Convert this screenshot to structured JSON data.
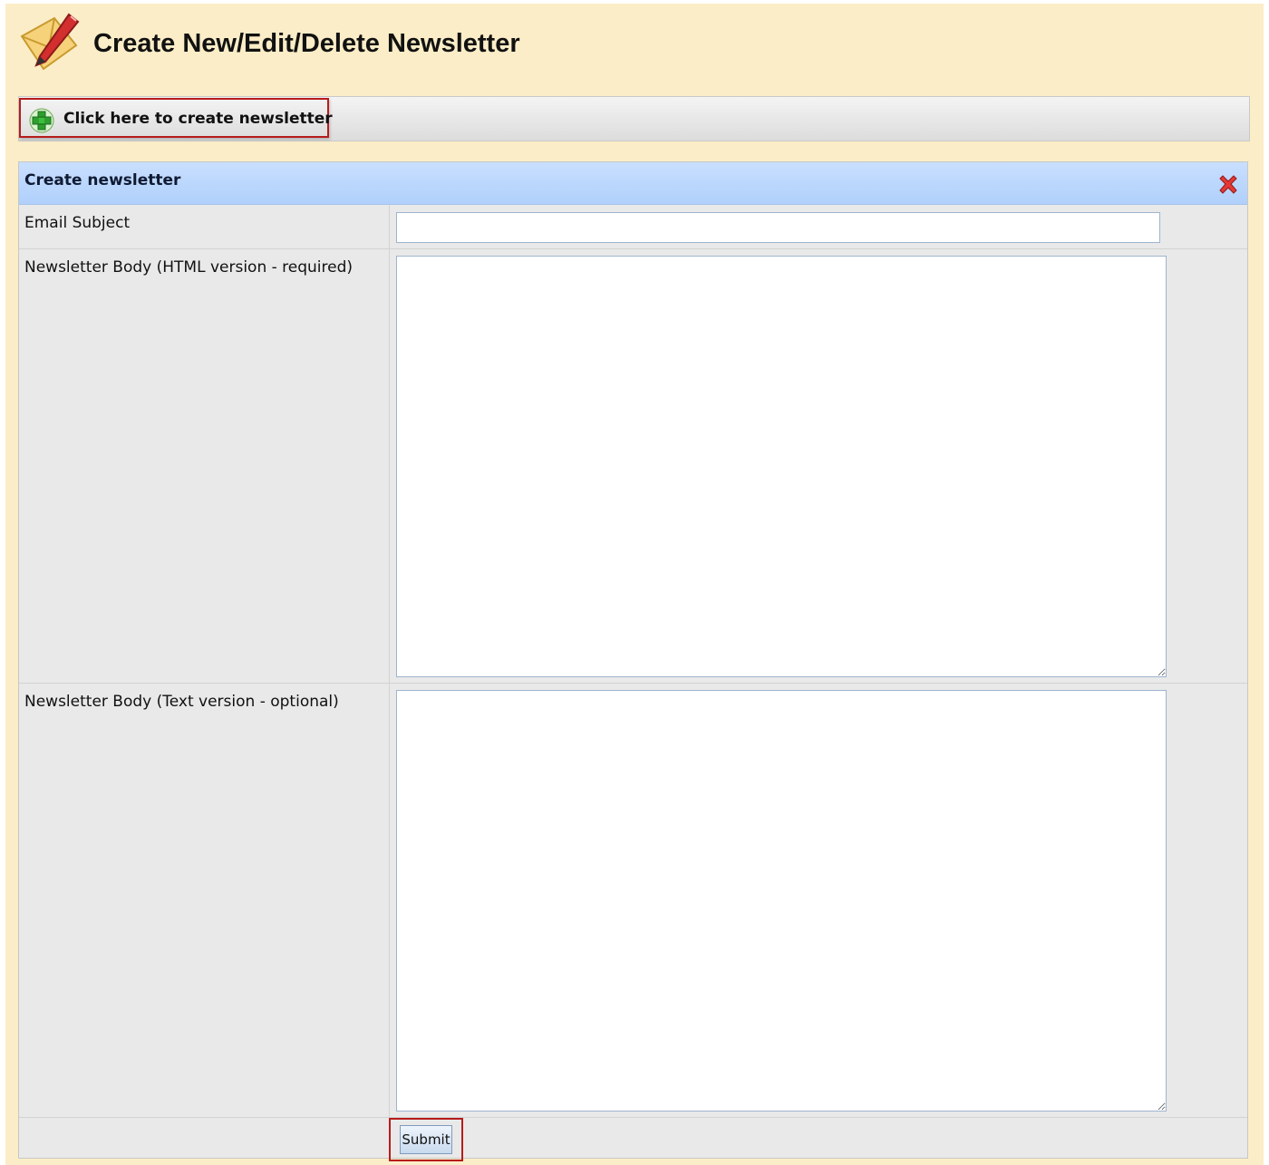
{
  "header": {
    "title": "Create New/Edit/Delete Newsletter",
    "logo_icon": "envelope-pen-icon"
  },
  "toolbar": {
    "create_label": "Click here to create newsletter",
    "create_icon": "green-plus-icon"
  },
  "panel": {
    "title": "Create newsletter",
    "close_icon": "red-x-close-icon",
    "fields": {
      "subject_label": "Email Subject",
      "subject_value": "",
      "html_body_label": "Newsletter Body (HTML version - required)",
      "html_body_value": "",
      "text_body_label": "Newsletter Body (Text version - optional)",
      "text_body_value": ""
    },
    "submit_label": "Submit"
  },
  "colors": {
    "page_bg": "#fbedc7",
    "panel_header_bg": "#b0d0fb",
    "highlight_border": "#b71c1c",
    "form_bg": "#e9e9e9"
  }
}
